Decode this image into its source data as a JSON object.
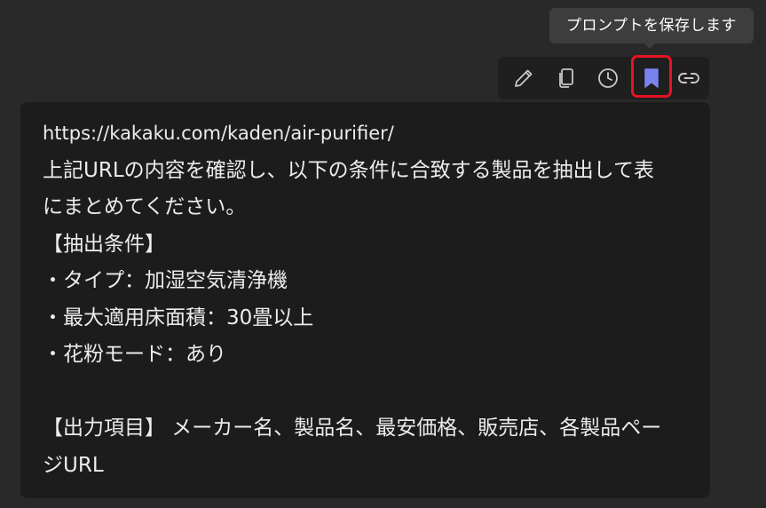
{
  "tooltip": {
    "text": "プロンプトを保存します"
  },
  "toolbar": {
    "buttons": [
      {
        "icon": "pencil-icon",
        "name": "edit-button"
      },
      {
        "icon": "copy-icon",
        "name": "copy-button"
      },
      {
        "icon": "clock-icon",
        "name": "history-button"
      },
      {
        "icon": "bookmark-icon",
        "name": "save-prompt-button",
        "active_color": "#7b83f0"
      },
      {
        "icon": "link-icon",
        "name": "link-button"
      }
    ],
    "highlight_color": "#e81224"
  },
  "message": {
    "lines": [
      "https://kakaku.com/kaden/air-purifier/",
      "上記URLの内容を確認し、以下の条件に合致する製品を抽出して表",
      "にまとめてください。",
      "【抽出条件】",
      "・タイプ：加湿空気清浄機",
      "・最大適用床面積：30畳以上",
      "・花粉モード：あり",
      "",
      "【出力項目】 メーカー名、製品名、最安価格、販売店、各製品ペー",
      "ジURL"
    ]
  }
}
